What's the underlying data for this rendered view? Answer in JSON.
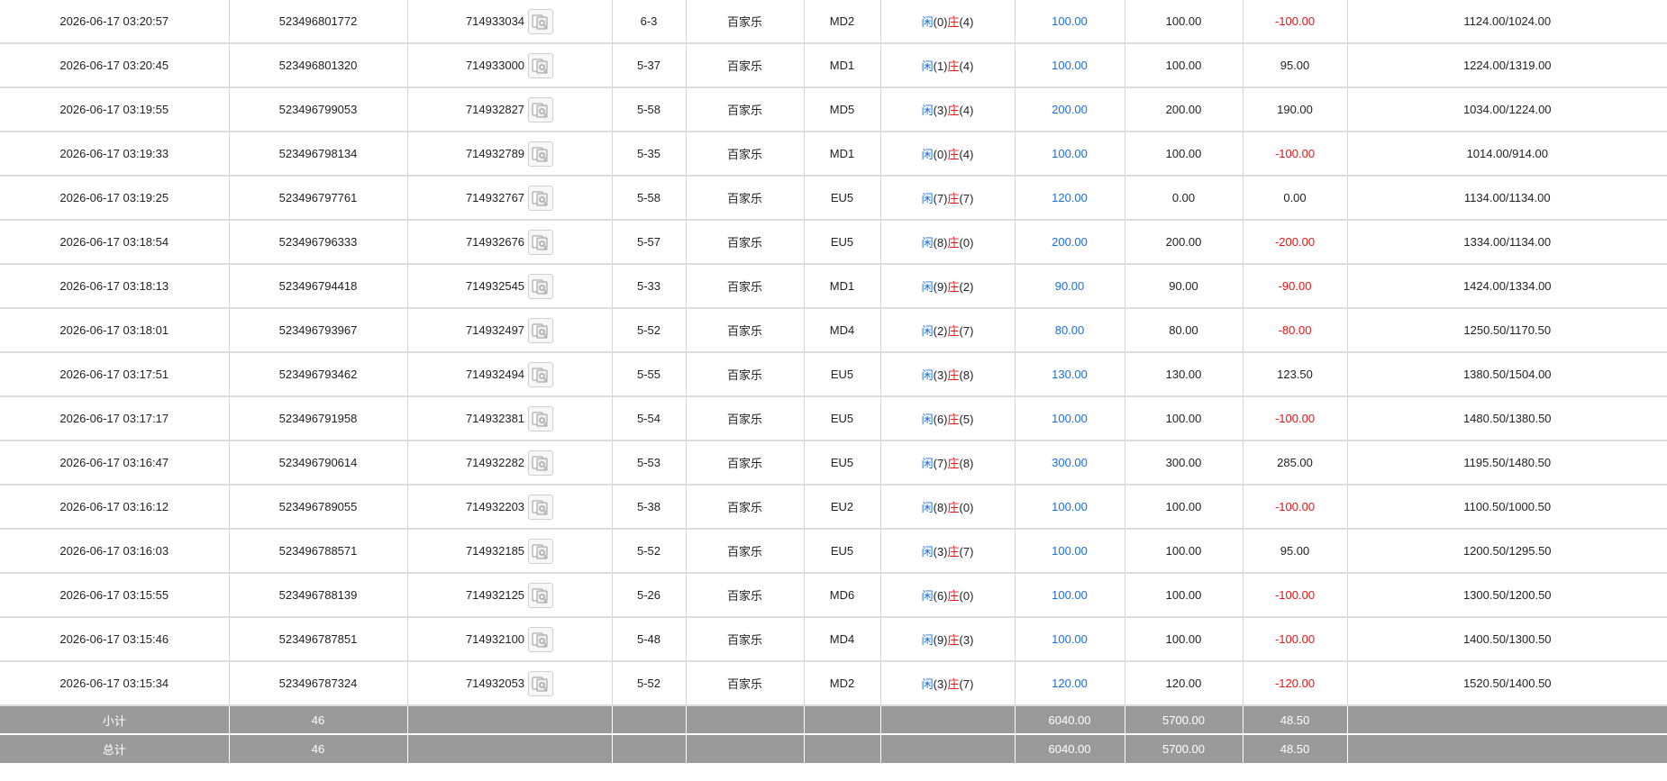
{
  "rows": [
    {
      "time": "2026-06-17 03:20:57",
      "bet_id": "523496801772",
      "round_id": "714933034",
      "table": "6-3",
      "game": "百家乐",
      "bet_type": "MD2",
      "player_label": "闲",
      "player_score": "(0)",
      "banker_label": "庄",
      "banker_score": "(4)",
      "bet_amount": "100.00",
      "valid_amount": "100.00",
      "win_loss": "-100.00",
      "win_loss_color": "red",
      "balance": "1124.00/1024.00"
    },
    {
      "time": "2026-06-17 03:20:45",
      "bet_id": "523496801320",
      "round_id": "714933000",
      "table": "5-37",
      "game": "百家乐",
      "bet_type": "MD1",
      "player_label": "闲",
      "player_score": "(1)",
      "banker_label": "庄",
      "banker_score": "(4)",
      "bet_amount": "100.00",
      "valid_amount": "100.00",
      "win_loss": "95.00",
      "win_loss_color": "black",
      "balance": "1224.00/1319.00"
    },
    {
      "time": "2026-06-17 03:19:55",
      "bet_id": "523496799053",
      "round_id": "714932827",
      "table": "5-58",
      "game": "百家乐",
      "bet_type": "MD5",
      "player_label": "闲",
      "player_score": "(3)",
      "banker_label": "庄",
      "banker_score": "(4)",
      "bet_amount": "200.00",
      "valid_amount": "200.00",
      "win_loss": "190.00",
      "win_loss_color": "black",
      "balance": "1034.00/1224.00"
    },
    {
      "time": "2026-06-17 03:19:33",
      "bet_id": "523496798134",
      "round_id": "714932789",
      "table": "5-35",
      "game": "百家乐",
      "bet_type": "MD1",
      "player_label": "闲",
      "player_score": "(0)",
      "banker_label": "庄",
      "banker_score": "(4)",
      "bet_amount": "100.00",
      "valid_amount": "100.00",
      "win_loss": "-100.00",
      "win_loss_color": "red",
      "balance": "1014.00/914.00"
    },
    {
      "time": "2026-06-17 03:19:25",
      "bet_id": "523496797761",
      "round_id": "714932767",
      "table": "5-58",
      "game": "百家乐",
      "bet_type": "EU5",
      "player_label": "闲",
      "player_score": "(7)",
      "banker_label": "庄",
      "banker_score": "(7)",
      "bet_amount": "120.00",
      "valid_amount": "0.00",
      "win_loss": "0.00",
      "win_loss_color": "black",
      "balance": "1134.00/1134.00"
    },
    {
      "time": "2026-06-17 03:18:54",
      "bet_id": "523496796333",
      "round_id": "714932676",
      "table": "5-57",
      "game": "百家乐",
      "bet_type": "EU5",
      "player_label": "闲",
      "player_score": "(8)",
      "banker_label": "庄",
      "banker_score": "(0)",
      "bet_amount": "200.00",
      "valid_amount": "200.00",
      "win_loss": "-200.00",
      "win_loss_color": "red",
      "balance": "1334.00/1134.00"
    },
    {
      "time": "2026-06-17 03:18:13",
      "bet_id": "523496794418",
      "round_id": "714932545",
      "table": "5-33",
      "game": "百家乐",
      "bet_type": "MD1",
      "player_label": "闲",
      "player_score": "(9)",
      "banker_label": "庄",
      "banker_score": "(2)",
      "bet_amount": "90.00",
      "valid_amount": "90.00",
      "win_loss": "-90.00",
      "win_loss_color": "red",
      "balance": "1424.00/1334.00"
    },
    {
      "time": "2026-06-17 03:18:01",
      "bet_id": "523496793967",
      "round_id": "714932497",
      "table": "5-52",
      "game": "百家乐",
      "bet_type": "MD4",
      "player_label": "闲",
      "player_score": "(2)",
      "banker_label": "庄",
      "banker_score": "(7)",
      "bet_amount": "80.00",
      "valid_amount": "80.00",
      "win_loss": "-80.00",
      "win_loss_color": "red",
      "balance": "1250.50/1170.50"
    },
    {
      "time": "2026-06-17 03:17:51",
      "bet_id": "523496793462",
      "round_id": "714932494",
      "table": "5-55",
      "game": "百家乐",
      "bet_type": "EU5",
      "player_label": "闲",
      "player_score": "(3)",
      "banker_label": "庄",
      "banker_score": "(8)",
      "bet_amount": "130.00",
      "valid_amount": "130.00",
      "win_loss": "123.50",
      "win_loss_color": "black",
      "balance": "1380.50/1504.00"
    },
    {
      "time": "2026-06-17 03:17:17",
      "bet_id": "523496791958",
      "round_id": "714932381",
      "table": "5-54",
      "game": "百家乐",
      "bet_type": "EU5",
      "player_label": "闲",
      "player_score": "(6)",
      "banker_label": "庄",
      "banker_score": "(5)",
      "bet_amount": "100.00",
      "valid_amount": "100.00",
      "win_loss": "-100.00",
      "win_loss_color": "red",
      "balance": "1480.50/1380.50"
    },
    {
      "time": "2026-06-17 03:16:47",
      "bet_id": "523496790614",
      "round_id": "714932282",
      "table": "5-53",
      "game": "百家乐",
      "bet_type": "EU5",
      "player_label": "闲",
      "player_score": "(7)",
      "banker_label": "庄",
      "banker_score": "(8)",
      "bet_amount": "300.00",
      "valid_amount": "300.00",
      "win_loss": "285.00",
      "win_loss_color": "black",
      "balance": "1195.50/1480.50"
    },
    {
      "time": "2026-06-17 03:16:12",
      "bet_id": "523496789055",
      "round_id": "714932203",
      "table": "5-38",
      "game": "百家乐",
      "bet_type": "EU2",
      "player_label": "闲",
      "player_score": "(8)",
      "banker_label": "庄",
      "banker_score": "(0)",
      "bet_amount": "100.00",
      "valid_amount": "100.00",
      "win_loss": "-100.00",
      "win_loss_color": "red",
      "balance": "1100.50/1000.50"
    },
    {
      "time": "2026-06-17 03:16:03",
      "bet_id": "523496788571",
      "round_id": "714932185",
      "table": "5-52",
      "game": "百家乐",
      "bet_type": "EU5",
      "player_label": "闲",
      "player_score": "(3)",
      "banker_label": "庄",
      "banker_score": "(7)",
      "bet_amount": "100.00",
      "valid_amount": "100.00",
      "win_loss": "95.00",
      "win_loss_color": "black",
      "balance": "1200.50/1295.50"
    },
    {
      "time": "2026-06-17 03:15:55",
      "bet_id": "523496788139",
      "round_id": "714932125",
      "table": "5-26",
      "game": "百家乐",
      "bet_type": "MD6",
      "player_label": "闲",
      "player_score": "(6)",
      "banker_label": "庄",
      "banker_score": "(0)",
      "bet_amount": "100.00",
      "valid_amount": "100.00",
      "win_loss": "-100.00",
      "win_loss_color": "red",
      "balance": "1300.50/1200.50"
    },
    {
      "time": "2026-06-17 03:15:46",
      "bet_id": "523496787851",
      "round_id": "714932100",
      "table": "5-48",
      "game": "百家乐",
      "bet_type": "MD4",
      "player_label": "闲",
      "player_score": "(9)",
      "banker_label": "庄",
      "banker_score": "(3)",
      "bet_amount": "100.00",
      "valid_amount": "100.00",
      "win_loss": "-100.00",
      "win_loss_color": "red",
      "balance": "1400.50/1300.50"
    },
    {
      "time": "2026-06-17 03:15:34",
      "bet_id": "523496787324",
      "round_id": "714932053",
      "table": "5-52",
      "game": "百家乐",
      "bet_type": "MD2",
      "player_label": "闲",
      "player_score": "(3)",
      "banker_label": "庄",
      "banker_score": "(7)",
      "bet_amount": "120.00",
      "valid_amount": "120.00",
      "win_loss": "-120.00",
      "win_loss_color": "red",
      "balance": "1520.50/1400.50"
    }
  ],
  "subtotal": {
    "label": "小计",
    "count": "46",
    "bet_amount": "6040.00",
    "valid_amount": "5700.00",
    "win_loss": "48.50"
  },
  "total": {
    "label": "总计",
    "count": "46",
    "bet_amount": "6040.00",
    "valid_amount": "5700.00",
    "win_loss": "48.50"
  },
  "colors": {
    "blue_text": "#1a6fe0",
    "red_text": "#ee1111",
    "summary_bg": "#9a9a9a",
    "summary_text": "#ffffff",
    "grid_line": "#dcdcdc"
  },
  "icons": {
    "detail_icon": "card-detail-icon"
  }
}
